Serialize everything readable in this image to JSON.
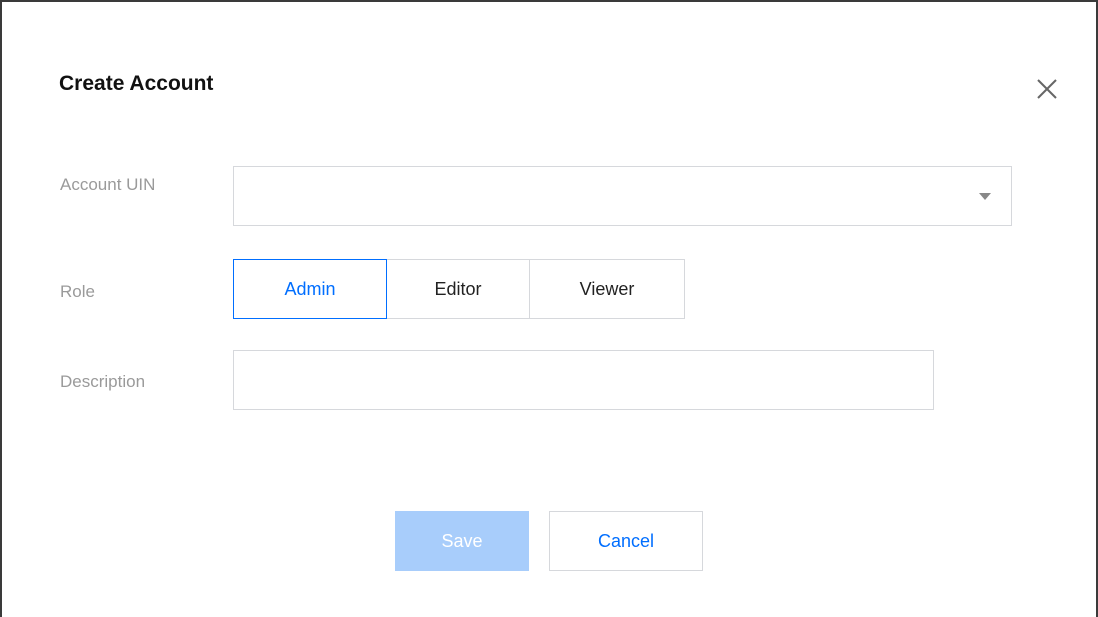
{
  "dialog": {
    "title": "Create Account",
    "close_icon": "close-icon"
  },
  "form": {
    "account_uin": {
      "label": "Account UIN",
      "value": "",
      "dropdown_icon": "caret-down-icon"
    },
    "role": {
      "label": "Role",
      "options": [
        "Admin",
        "Editor",
        "Viewer"
      ],
      "selected": "Admin"
    },
    "description": {
      "label": "Description",
      "value": "",
      "placeholder": ""
    }
  },
  "actions": {
    "save_label": "Save",
    "save_enabled": false,
    "cancel_label": "Cancel"
  },
  "colors": {
    "accent": "#006eff",
    "disabled_primary": "#a8cdfb",
    "border": "#d6d8dc",
    "label_text": "#9a9a9a"
  }
}
